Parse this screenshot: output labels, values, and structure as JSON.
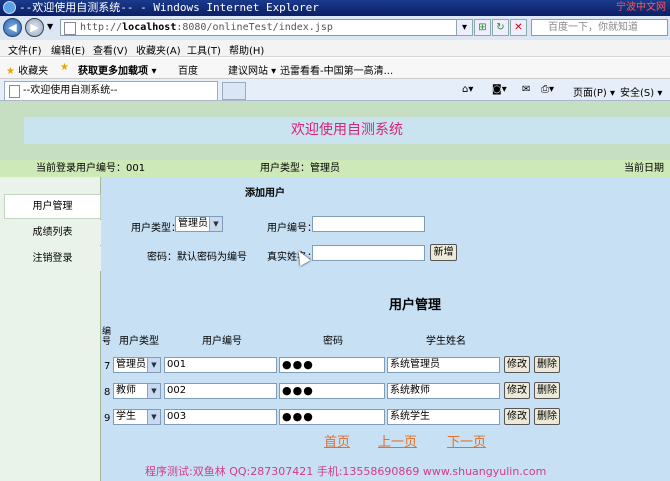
{
  "window": {
    "title": "--欢迎使用自测系统-- - Windows Internet Explorer",
    "corner_text": "宁波中文网"
  },
  "address": {
    "scheme": "http://",
    "host": "localhost",
    "path": ":8080/onlineTest/index.jsp",
    "search_placeholder": "百度一下，你就知道"
  },
  "menu": [
    "文件(F)",
    "编辑(E)",
    "查看(V)",
    "收藏夹(A)",
    "工具(T)",
    "帮助(H)"
  ],
  "favorites": {
    "label": "收藏夹",
    "items": [
      "获取更多加载项 ▾",
      "百度",
      "建议网站 ▾",
      "迅雷看看-中国第一高清..."
    ]
  },
  "tab": {
    "title": "--欢迎使用自测系统--"
  },
  "toolbar_right": {
    "page": "页面(P) ▾",
    "safety": "安全(S) ▾"
  },
  "page": {
    "banner": "欢迎使用自测系统",
    "info": {
      "user_id": "当前登录用户编号：001",
      "user_type": "用户类型：管理员",
      "date": "当前日期"
    },
    "sidebar": [
      "用户管理",
      "成绩列表",
      "注销登录"
    ],
    "add_user": {
      "heading": "添加用户",
      "type_label": "用户类型：",
      "type_value": "管理员",
      "id_label": "用户编号：",
      "pwd_note": "密码：默认密码为编号",
      "name_label": "真实姓名：",
      "add_button": "新增"
    },
    "manage": {
      "heading": "用户管理",
      "headers": {
        "no": "编号",
        "type": "用户类型",
        "id": "用户编号",
        "pwd": "密码",
        "name": "学生姓名"
      },
      "rows": [
        {
          "no": "7",
          "type": "管理员",
          "id": "001",
          "pwd": "●●●",
          "name": "系统管理员",
          "edit": "修改",
          "del": "删除"
        },
        {
          "no": "8",
          "type": "教师",
          "id": "002",
          "pwd": "●●●",
          "name": "系统教师",
          "edit": "修改",
          "del": "删除"
        },
        {
          "no": "9",
          "type": "学生",
          "id": "003",
          "pwd": "●●●",
          "name": "系统学生",
          "edit": "修改",
          "del": "删除"
        }
      ],
      "pager": {
        "first": "首页",
        "prev": "上一页",
        "next": "下一页"
      }
    },
    "footer": "程序测试:双鱼林 QQ:287307421 手机:13558690869 www.shuangyulin.com"
  }
}
